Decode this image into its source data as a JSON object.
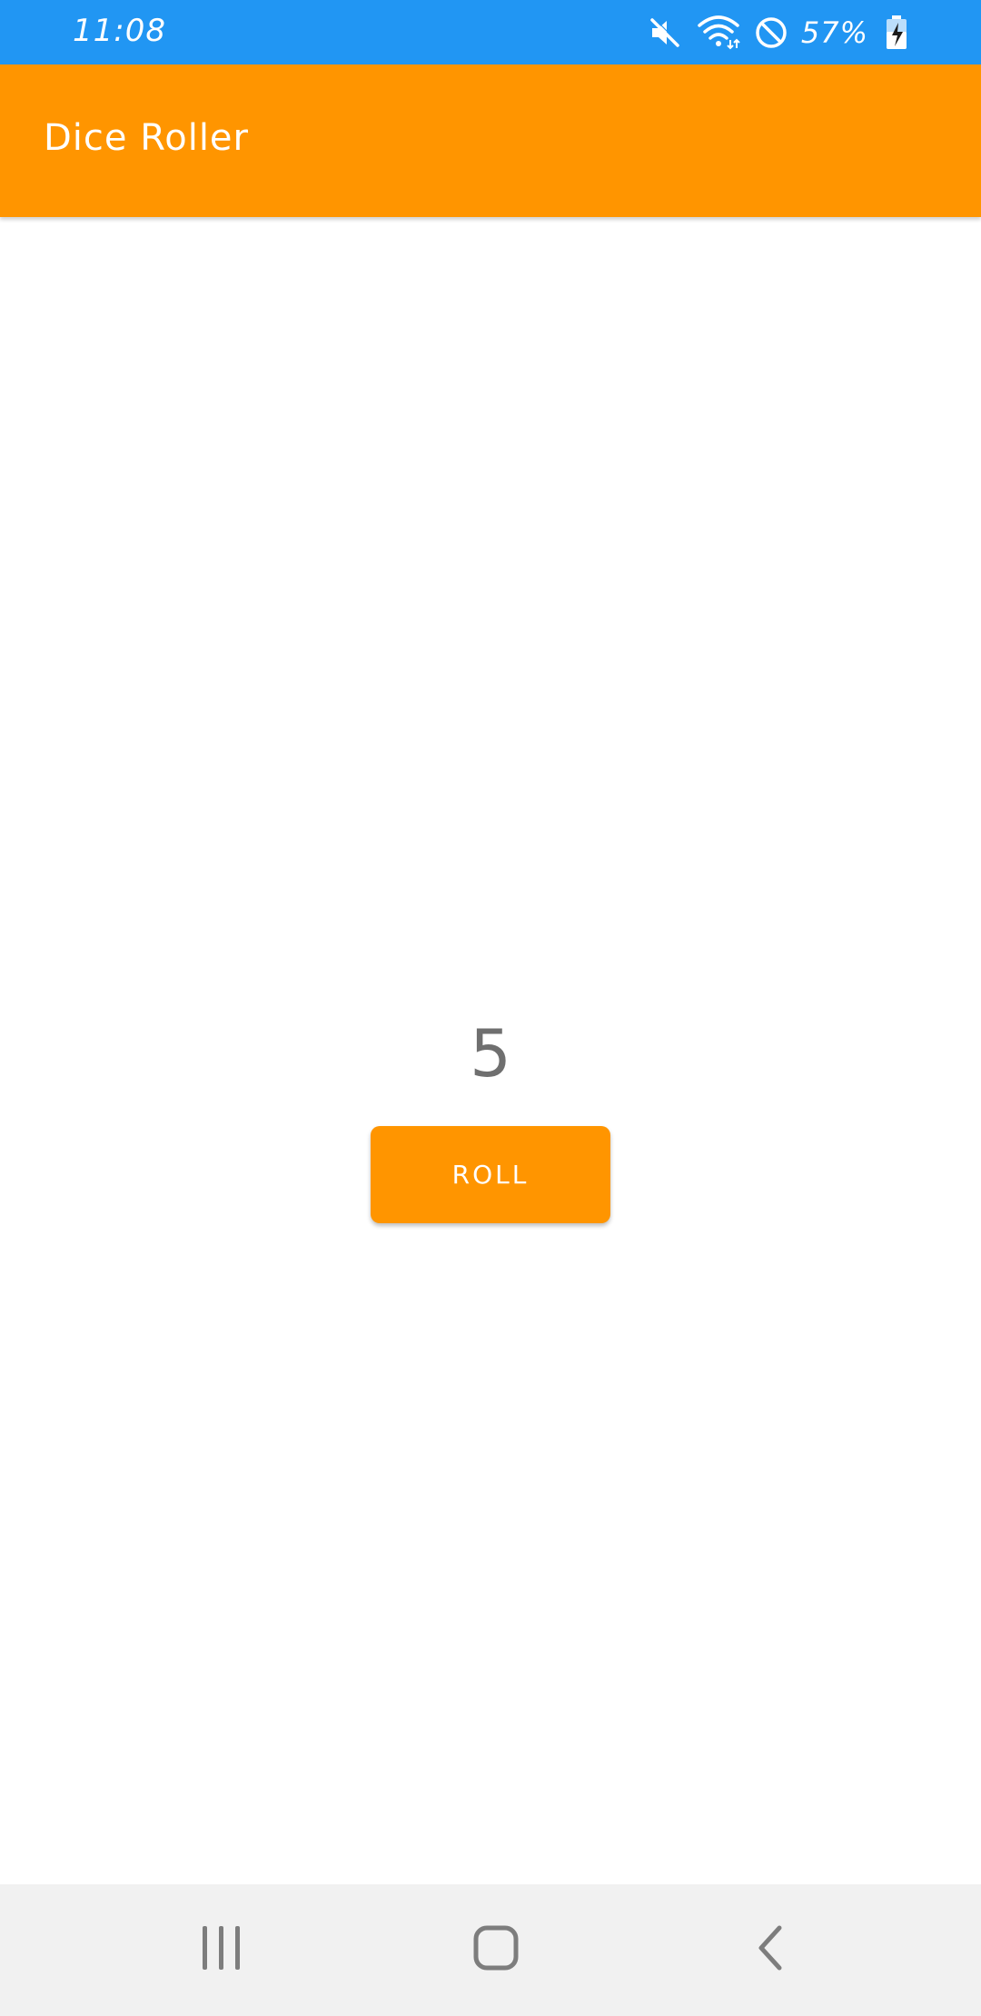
{
  "status_bar": {
    "time": "11:08",
    "battery_percent": "57%",
    "icons": [
      "mute-icon",
      "wifi-icon",
      "do-not-disturb-icon",
      "battery-charging-icon"
    ],
    "background_color": "#2196F3"
  },
  "app_bar": {
    "title": "Dice Roller",
    "background_color": "#FF9500"
  },
  "main": {
    "result_value": "5",
    "roll_button_label": "ROLL",
    "accent_color": "#FF9500"
  },
  "nav_bar": {
    "buttons": [
      "recents-icon",
      "home-icon",
      "back-icon"
    ],
    "background_color": "#F1F1F1"
  }
}
